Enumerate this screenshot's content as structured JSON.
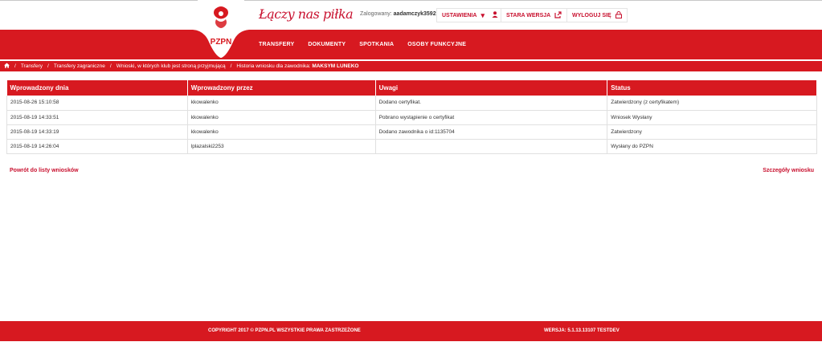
{
  "header": {
    "slogan": "Łączy nas piłka",
    "user_label": "Zalogowany:",
    "username": "aadamczyk3592",
    "settings_label": "USTAWIENIA",
    "old_version_label": "STARA WERSJA",
    "logout_label": "WYLOGUJ SIĘ",
    "logo_text": "PZPN"
  },
  "nav": [
    "TRANSFERY",
    "DOKUMENTY",
    "SPOTKANIA",
    "OSOBY FUNKCYJNE"
  ],
  "breadcrumb": {
    "items": [
      "Transfery",
      "Transfery zagraniczne",
      "Wnioski, w których klub jest stroną przyjmującą"
    ],
    "current_prefix": "Historia wniosku dla zawodnika:",
    "current_name": "MAKSYM LUNEKO"
  },
  "table": {
    "headers": [
      "Wprowadzony dnia",
      "Wprowadzony przez",
      "Uwagi",
      "Status"
    ],
    "rows": [
      [
        "2015-08-26 15:10:58",
        "kkowalenko",
        "Dodano certyfikat.",
        "Zatwierdzony (z certyfikatem)"
      ],
      [
        "2015-08-19 14:33:51",
        "kkowalenko",
        "Pobrano wystąpienie o certyfikat",
        "Wniosek Wysłany"
      ],
      [
        "2015-08-19 14:33:19",
        "kkowalenko",
        "Dodano zawodnika o id:1135704",
        "Zatwierdzony"
      ],
      [
        "2015-08-19 14:26:04",
        "lplazalski2253",
        "",
        "Wysłany do PZPN"
      ]
    ]
  },
  "links": {
    "back": "Powrót do listy wniosków",
    "details": "Szczegóły wniosku"
  },
  "footer": {
    "copyright": "COPYRIGHT 2017 © PZPN.PL WSZYSTKIE PRAWA ZASTRZEŻONE",
    "version": "WERSJA: 5.1.13.13107 TESTDEV"
  },
  "colors": {
    "brand_red": "#d71920"
  }
}
